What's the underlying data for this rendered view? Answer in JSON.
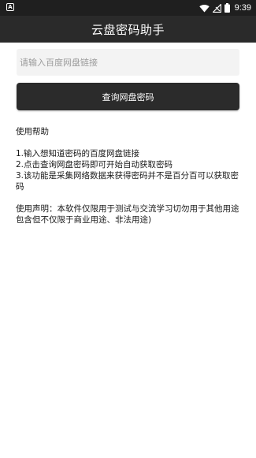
{
  "status_bar": {
    "left_icon": "A",
    "icons": [
      "wifi-icon",
      "signal-icon",
      "battery-icon"
    ],
    "time": "9:39"
  },
  "toolbar": {
    "title": "云盘密码助手"
  },
  "search": {
    "placeholder": "请输入百度网盘链接",
    "value": ""
  },
  "query_button": {
    "label": "查询网盘密码"
  },
  "help": {
    "heading": "使用帮助",
    "steps": [
      "1.输入想知道密码的百度网盘链接",
      "2.点击查询网盘密码即可开始自动获取密码",
      "3.该功能是采集网络数据来获得密码并不是百分百可以获取密码"
    ],
    "disclaimer": "使用声明：本软件仅限用于测试与交流学习切勿用于其他用途包含但不仅限于商业用途、非法用途)"
  },
  "colors": {
    "status_bar_bg": "#1f1f1f",
    "toolbar_bg": "#2a2a2a",
    "button_bg": "#2b2b2b",
    "input_bg": "#f3f3f3",
    "text": "#1a1a1a"
  }
}
